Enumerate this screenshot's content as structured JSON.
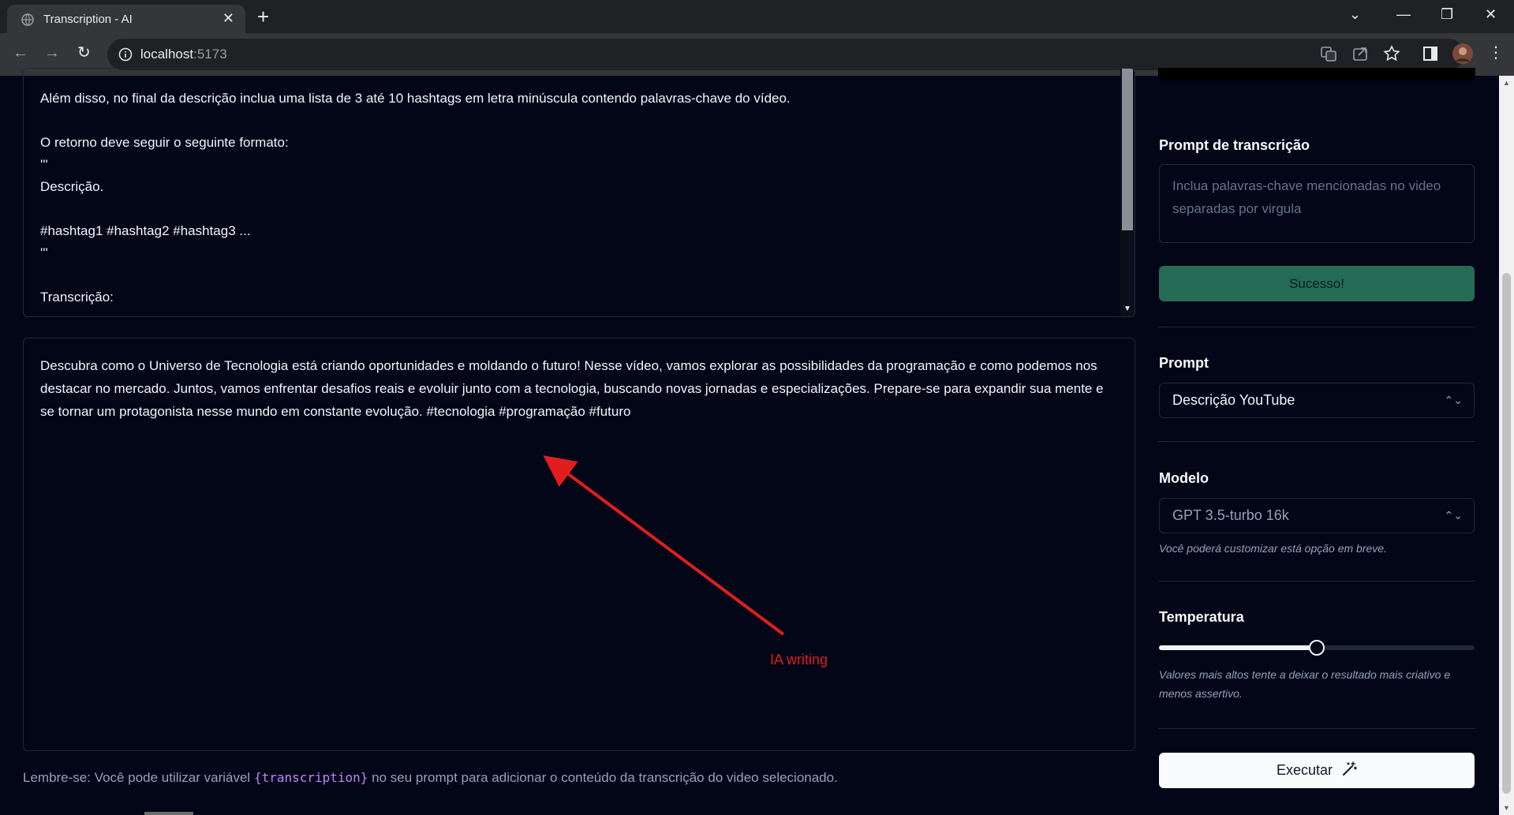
{
  "browser": {
    "tab_title": "Transcription - AI",
    "url_host": "localhost",
    "url_port": ":5173"
  },
  "prompt_editor": {
    "text": "Além disso, no final da descrição inclua uma lista de 3 até 10 hashtags em letra minúscula contendo palavras-chave do vídeo.\n\nO retorno deve seguir o seguinte formato:\n'''\nDescrição.\n\n#hashtag1 #hashtag2 #hashtag3 ...\n'''\n\nTranscrição:"
  },
  "result": {
    "text": "Descubra como o Universo de Tecnologia está criando oportunidades e moldando o futuro! Nesse vídeo, vamos explorar as possibilidades da programação e como podemos nos destacar no mercado. Juntos, vamos enfrentar desafios reais e evoluir junto com a tecnologia, buscando novas jornadas e especializações. Prepare-se para expandir sua mente e se tornar um protagonista nesse mundo em constante evolução. #tecnologia #programação #futuro"
  },
  "annotation": {
    "label": "IA writing",
    "color": "#e11d1d"
  },
  "hint": {
    "before": "Lembre-se: Você pode utilizar variável ",
    "variable": "{transcription}",
    "after": " no seu prompt para adicionar o conteúdo da transcrição do video selecionado."
  },
  "sidebar": {
    "transcription_prompt_label": "Prompt de transcrição",
    "transcription_prompt_placeholder": "Inclua palavras-chave mencionadas no video separadas por virgula",
    "success_button": "Sucesso!",
    "prompt_label": "Prompt",
    "prompt_selected": "Descrição YouTube",
    "model_label": "Modelo",
    "model_selected": "GPT 3.5-turbo 16k",
    "model_hint": "Você poderá customizar está opção em breve.",
    "temperature_label": "Temperatura",
    "temperature_value": 0.5,
    "temperature_hint": "Valores mais altos tente a deixar o resultado mais criativo e menos assertivo.",
    "execute_button": "Executar"
  },
  "colors": {
    "background": "#020617",
    "success": "#256b55",
    "accent_variable": "#c084fc"
  }
}
